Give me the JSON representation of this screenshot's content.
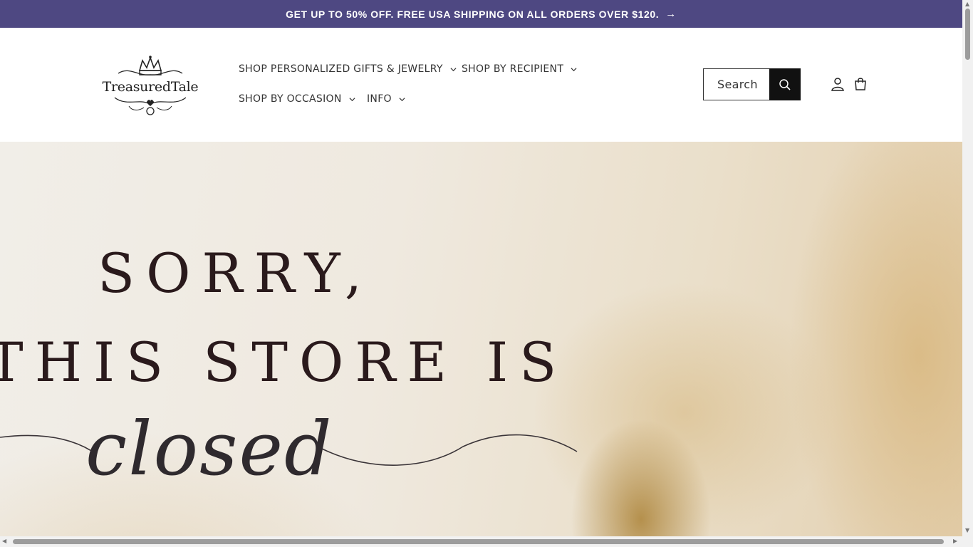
{
  "announcement": {
    "text": "GET UP TO 50% OFF. FREE USA SHIPPING ON ALL ORDERS OVER $120.",
    "arrow_icon": "arrow-right-icon"
  },
  "header": {
    "logo_text": "TreasuredTale",
    "nav": [
      {
        "label": "SHOP PERSONALIZED GIFTS & JEWELRY"
      },
      {
        "label": "SHOP BY RECIPIENT"
      },
      {
        "label": "SHOP BY OCCASION"
      },
      {
        "label": "INFO"
      }
    ],
    "search_label": "Search",
    "icons": [
      "search-icon",
      "account-icon",
      "cart-icon"
    ]
  },
  "hero": {
    "line1": "SORRY,",
    "line2": "THIS STORE IS",
    "line3": "closed"
  },
  "colors": {
    "announcement_bg": "#4e4882",
    "text_dark": "#2a1a1c"
  }
}
